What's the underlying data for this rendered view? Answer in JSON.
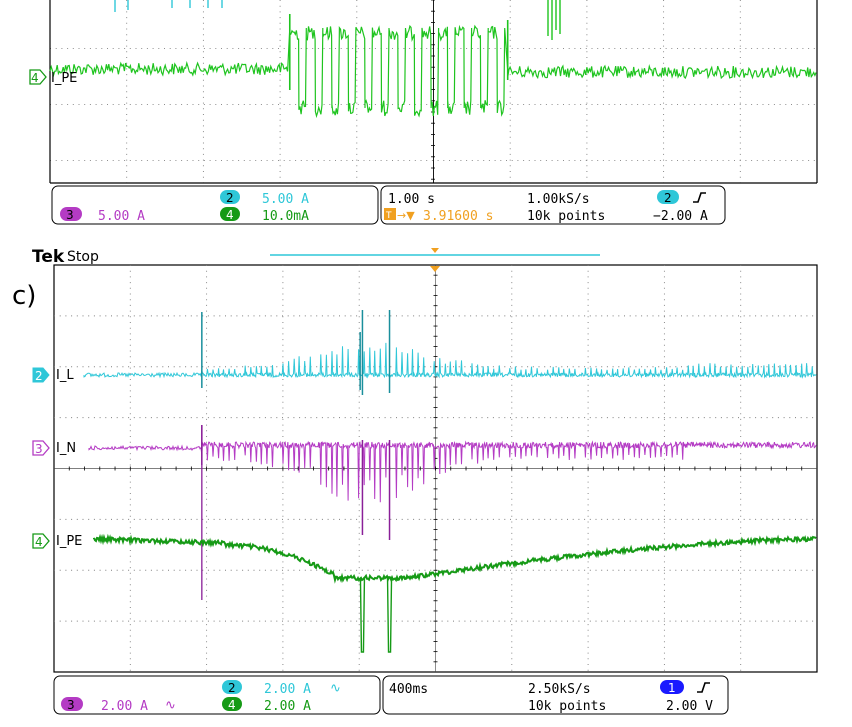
{
  "top_panel": {
    "label_ch4": "I_PE",
    "marker_ch4": "4",
    "status": {
      "ch2_num": "2",
      "ch2_scale": "5.00 A",
      "ch3_num": "3",
      "ch3_scale": "5.00 A",
      "ch4_num": "4",
      "ch4_scale": "10.0mA",
      "timebase": "1.00 s",
      "trigger_pos": "3.91600 s",
      "sample_rate": "1.00kS/s",
      "record_length": "10k points",
      "trig_ch": "2",
      "trig_level": "−2.00 A"
    }
  },
  "bottom_panel": {
    "brand": "Tek",
    "run_state": "Stop",
    "panel_label": "c)",
    "label_ch2": "I_L",
    "marker_ch2": "2",
    "label_ch3": "I_N",
    "marker_ch3": "3",
    "label_ch4": "I_PE",
    "marker_ch4": "4",
    "status": {
      "ch2_num": "2",
      "ch2_scale": "2.00 A",
      "ch3_num": "3",
      "ch3_scale": "2.00 A",
      "ch4_num": "4",
      "ch4_scale": "2.00 A",
      "timebase": "400ms",
      "sample_rate": "2.50kS/s",
      "record_length": "10k points",
      "trig_ch": "1",
      "trig_level": "2.00 V",
      "bw_symbol": "∿"
    }
  },
  "colors": {
    "ch1": "#1a1aff",
    "ch2": "#2fc7d8",
    "ch3": "#b43bc4",
    "ch4": "#1fc41f",
    "ch4_dark": "#169a16",
    "trigger": "#f0a020",
    "grid": "#7f7f7f"
  },
  "chart_data": [
    {
      "type": "line",
      "title": "",
      "x_unit": "s",
      "x_range_s": [
        -5.0,
        5.0
      ],
      "series": [
        {
          "name": "I_PE",
          "channel": 4,
          "scale": "10.0mA/div",
          "description_points": [
            {
              "t_s": -5.0,
              "level_div": 0.6
            },
            {
              "t_s": -1.9,
              "level_div": 0.6
            },
            {
              "t_s": -1.85,
              "square_wave_high_div": 1.2,
              "square_wave_low_div": -0.7
            },
            {
              "t_s": 0.85,
              "level_div": 0.6
            },
            {
              "t_s": 1.1,
              "burst": true
            },
            {
              "t_s": 5.0,
              "level_div": 0.6
            }
          ],
          "square_wave_cycles": 13
        }
      ]
    },
    {
      "type": "line",
      "title": "",
      "x_unit": "ms",
      "x_div": "400ms",
      "x_range_ms": [
        -2000,
        2000
      ],
      "series": [
        {
          "name": "I_L",
          "channel": 2,
          "scale": "2.00 A/div",
          "baseline_div": 0,
          "events_ms": [
            -1225,
            -383,
            -241
          ],
          "ripple_peak_div": 0.7
        },
        {
          "name": "I_N",
          "channel": 3,
          "scale": "2.00 A/div",
          "baseline_div": 0,
          "events_ms": [
            -1225,
            -383,
            -241
          ],
          "dip_peak_div": -1.2
        },
        {
          "name": "I_PE",
          "channel": 4,
          "scale": "2.00 A/div",
          "baseline_div": 0,
          "min_level_div": -0.75,
          "min_at_ms": -350,
          "spikes_ms": [
            -380,
            -240
          ],
          "spike_depth_div": -2.1
        }
      ]
    }
  ]
}
